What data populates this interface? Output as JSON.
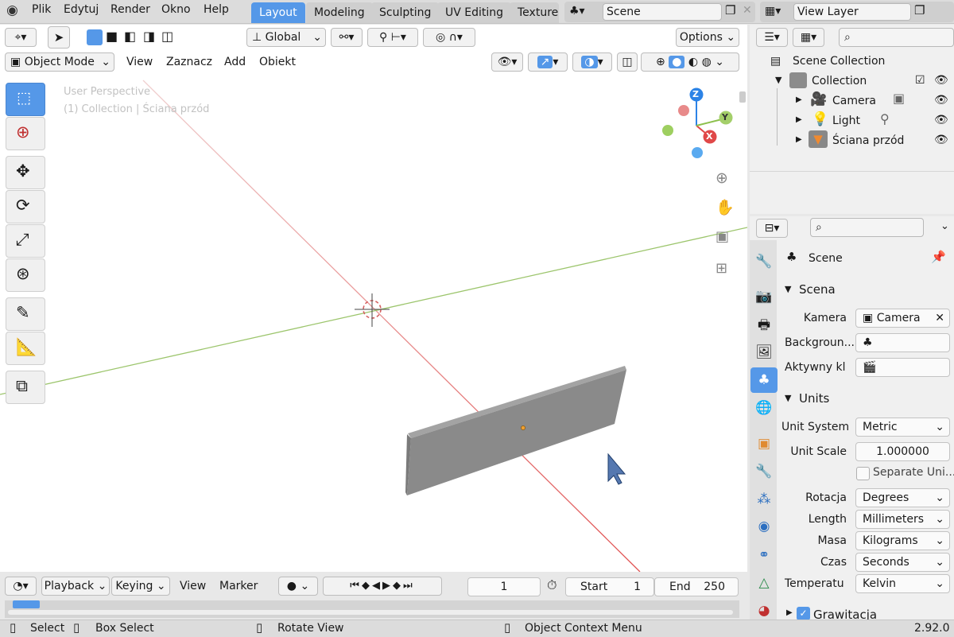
{
  "topbar": {
    "menus": [
      "Plik",
      "Edytuj",
      "Render",
      "Okno",
      "Help"
    ],
    "workspace_tabs": [
      "Layout",
      "Modeling",
      "Sculpting",
      "UV Editing",
      "Texture"
    ],
    "scene_name": "Scene",
    "view_layer_name": "View Layer"
  },
  "viewport_header": {
    "orientation": "Global",
    "options_label": "Options",
    "mode": "Object Mode",
    "menus": [
      "View",
      "Zaznacz",
      "Add",
      "Obiekt"
    ]
  },
  "viewport": {
    "perspective_label": "User Perspective",
    "context_label": "(1) Collection | Ściana przód",
    "gizmo_axes": {
      "x": "X",
      "y": "Y",
      "z": "Z"
    }
  },
  "outliner": {
    "root": "Scene Collection",
    "collection": "Collection",
    "items": [
      "Camera",
      "Light",
      "Ściana przód"
    ]
  },
  "properties": {
    "context_title": "Scene",
    "scena_section": "Scena",
    "kamera_label": "Kamera",
    "kamera_value": "Camera",
    "background_label": "Backgroun...",
    "aktywny_label": "Aktywny kl",
    "units_section": "Units",
    "unit_system_label": "Unit System",
    "unit_system_value": "Metric",
    "unit_scale_label": "Unit Scale",
    "unit_scale_value": "1.000000",
    "separate_units_label": "Separate Uni...",
    "rotacja_label": "Rotacja",
    "rotacja_value": "Degrees",
    "length_label": "Length",
    "length_value": "Millimeters",
    "masa_label": "Masa",
    "masa_value": "Kilograms",
    "czas_label": "Czas",
    "czas_value": "Seconds",
    "temperatura_label": "Temperatu",
    "temperatura_value": "Kelvin",
    "grawitacja_label": "Grawitacja"
  },
  "timeline": {
    "menus": [
      "Playback",
      "Keying",
      "View",
      "Marker"
    ],
    "current_frame": "1",
    "start_label": "Start",
    "start_value": "1",
    "end_label": "End",
    "end_value": "250"
  },
  "statusbar": {
    "select": "Select",
    "box_select": "Box Select",
    "rotate_view": "Rotate View",
    "context_menu": "Object Context Menu",
    "version": "2.92.0"
  },
  "colors": {
    "accent": "#5598e8",
    "x_axis": "#e04848",
    "y_axis": "#8cc04c",
    "z_axis": "#2c83e6",
    "object": "#8a8a8a"
  }
}
